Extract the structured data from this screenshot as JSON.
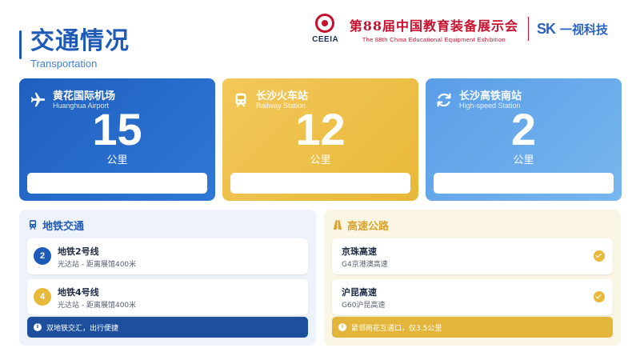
{
  "header": {
    "title": "交通情况",
    "subtitle": "Transportation"
  },
  "logos": {
    "ceeia": "CEEIA",
    "expo_cn": "第88届中国教育装备展示会",
    "expo_en": "The 88th China Educational Equipment Exhibition",
    "sk": "SK",
    "brand": "一视科技"
  },
  "cards": [
    {
      "name": "黄花国际机场",
      "name_en": "Huanghua Airport",
      "value": "15",
      "unit": "公里",
      "icon": "airplane-icon"
    },
    {
      "name": "长沙火车站",
      "name_en": "Railway Station",
      "value": "12",
      "unit": "公里",
      "icon": "train-icon"
    },
    {
      "name": "长沙高铁南站",
      "name_en": "High-speed Station",
      "value": "2",
      "unit": "公里",
      "icon": "refresh-icon"
    }
  ],
  "metro": {
    "title": "地铁交通",
    "icon": "metro-icon",
    "lines": [
      {
        "badge": "2",
        "title": "地铁2号线",
        "sub": "光达站 - 距离展馆400米"
      },
      {
        "badge": "4",
        "title": "地铁4号线",
        "sub": "光达站 - 距离展馆400米"
      }
    ],
    "notice": "双地铁交汇，出行便捷"
  },
  "highway": {
    "title": "高速公路",
    "icon": "road-icon",
    "roads": [
      {
        "title": "京珠高速",
        "sub": "G4京港澳高速"
      },
      {
        "title": "沪昆高速",
        "sub": "G60沪昆高速"
      }
    ],
    "notice": "紧邻雨花互通口，仅3.5公里"
  },
  "colors": {
    "primary": "#1e5bb8",
    "gold": "#e8b839",
    "light_blue": "#5a9ee8",
    "brand_red": "#c8102e"
  }
}
